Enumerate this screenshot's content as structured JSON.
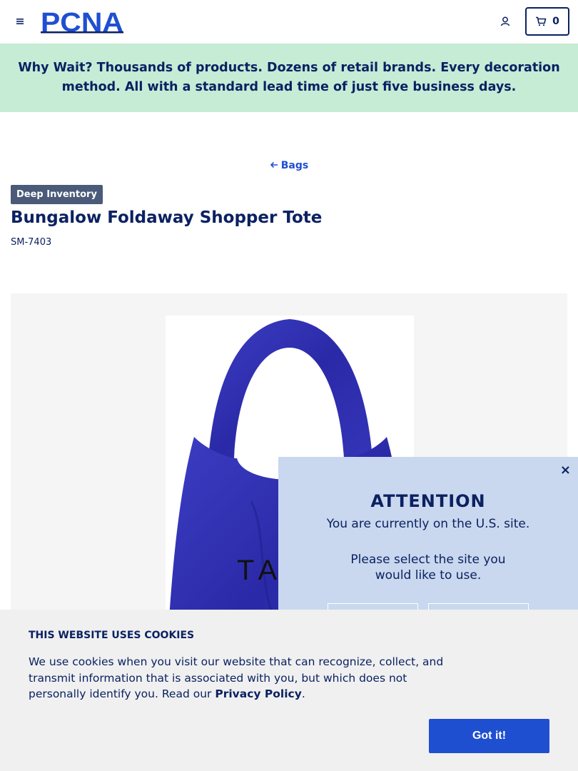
{
  "header": {
    "logo_text": "PCNA",
    "cart_count": "0"
  },
  "banner": {
    "lead": "Why Wait?",
    "text": " Thousands of products. Dozens of retail brands. Every decoration method. All with a standard lead time of just five business days."
  },
  "breadcrumb": {
    "back_label": "Bags"
  },
  "product": {
    "badge": "Deep Inventory",
    "title": "Bungalow Foldaway Shopper Tote",
    "sku": "SM-7403",
    "image_visible_text": "TA",
    "bag_color": "#2f2fb0"
  },
  "modal": {
    "close_symbol": "×",
    "title": "ATTENTION",
    "line1": "You are currently on the U.S. site.",
    "line2": "Please select the site you would like to use."
  },
  "cookie": {
    "title": "THIS WEBSITE USES COOKIES",
    "text": "We use cookies when you visit our website that can recognize, collect, and transmit information that is associated with you, but which does not personally identify you. Read our ",
    "link": "Privacy Policy",
    "period": ".",
    "button": "Got it!"
  },
  "colors": {
    "brand_navy": "#0b2162",
    "accent_blue": "#1f4fd1",
    "banner_green": "#c6ecd6",
    "modal_bg": "#c9d8ee"
  }
}
